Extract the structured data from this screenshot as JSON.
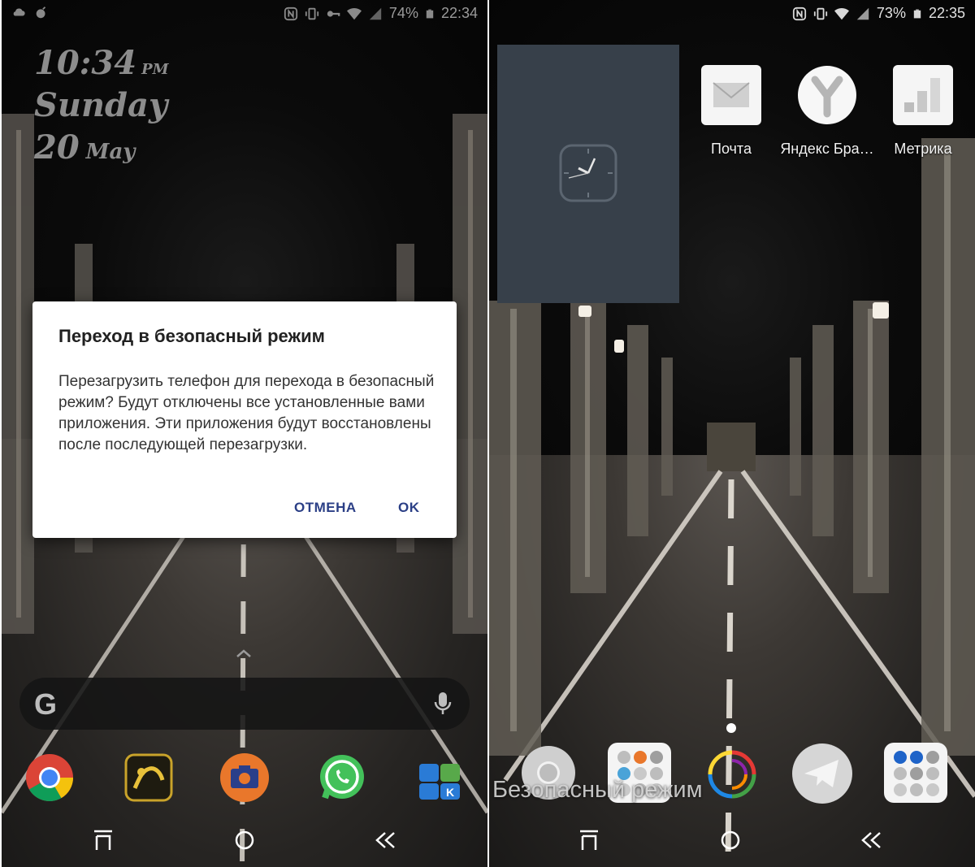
{
  "left_screen": {
    "status_bar": {
      "battery": "74%",
      "time": "22:34",
      "icons": [
        "cloud-icon",
        "bomb-icon",
        "nfc-icon",
        "vibrate-icon",
        "key-icon",
        "wifi-icon",
        "signal-icon",
        "battery-icon"
      ]
    },
    "lock_clock": {
      "time": "10:34",
      "ampm": "PM",
      "day": "Sunday",
      "date": "20",
      "month": "May"
    },
    "dialog": {
      "title": "Переход в безопасный режим",
      "message": "Перезагрузить телефон для перехода в безопасный режим? Будут отключены все установленные вами приложения. Эти приложения будут восстановлены после последующей перезагрузки.",
      "cancel": "ОТМЕНА",
      "ok": "OK",
      "accent": "#2b3f86"
    },
    "search_bar": {
      "logo": "G",
      "icon": "mic-icon"
    },
    "dock": [
      "chrome-icon",
      "game-app-icon",
      "camera-icon",
      "whatsapp-icon",
      "contacts-folder-icon"
    ],
    "nav": [
      "recents-icon",
      "home-icon",
      "back-icon"
    ]
  },
  "right_screen": {
    "status_bar": {
      "battery": "73%",
      "time": "22:35",
      "icons": [
        "nfc-icon",
        "vibrate-icon",
        "wifi-icon",
        "signal-icon",
        "battery-icon"
      ]
    },
    "clock_widget": {
      "icon": "clock-icon",
      "background": "#37404a"
    },
    "apps": [
      {
        "label": "Почта",
        "icon": "mail-icon"
      },
      {
        "label": "Яндекс Бра…",
        "icon": "yandex-browser-icon"
      },
      {
        "label": "Метрика",
        "icon": "metrica-icon"
      }
    ],
    "dock": [
      "chrome-icon",
      "apps-folder-icon",
      "spiral-app-icon",
      "telegram-icon",
      "messengers-folder-icon"
    ],
    "safe_mode_label": "Безопасный режим",
    "nav": [
      "recents-icon",
      "home-icon",
      "back-icon"
    ]
  }
}
